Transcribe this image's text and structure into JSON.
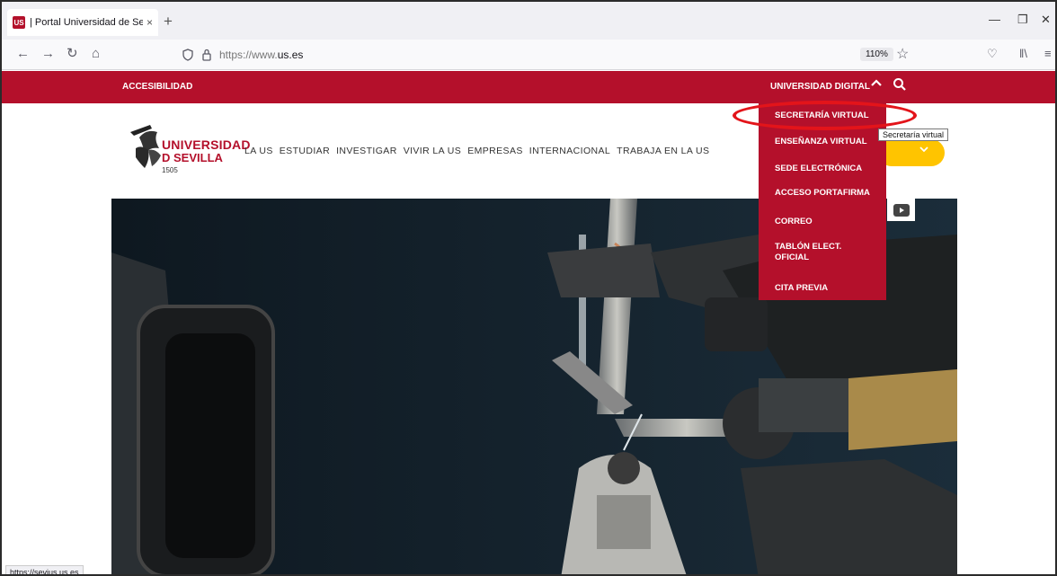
{
  "browser": {
    "tab_title": "| Portal Universidad de Sevilla",
    "favicon": "US",
    "tab_close": "×",
    "new_tab": "+",
    "url_prefix": "https://www.",
    "url_domain": "us.es",
    "zoom": "110%",
    "status_url": "https://sevius.us.es"
  },
  "site": {
    "accessibility": "ACCESIBILIDAD",
    "universidad_digital": "UNIVERSIDAD DIGITAL",
    "logo_line1": "UNIVERSIDAD",
    "logo_line2": "D SEVILLA",
    "logo_year": "1505",
    "nav": [
      "LA US",
      "ESTUDIAR",
      "INVESTIGAR",
      "VIVIR LA US",
      "EMPRESAS",
      "INTERNACIONAL",
      "TRABAJA EN LA US"
    ],
    "dropdown": [
      "SECRETARÍA VIRTUAL",
      "ENSEÑANZA VIRTUAL",
      "SEDE ELECTRÓNICA",
      "ACCESO PORTAFIRMA",
      "CORREO",
      "TABLÓN ELECT. OFICIAL",
      "CITA PREVIA"
    ],
    "tooltip": "Secretaría virtual"
  },
  "colors": {
    "brand_red": "#b4102b",
    "highlight": "#e3141a",
    "accent_yellow": "#ffc400"
  }
}
